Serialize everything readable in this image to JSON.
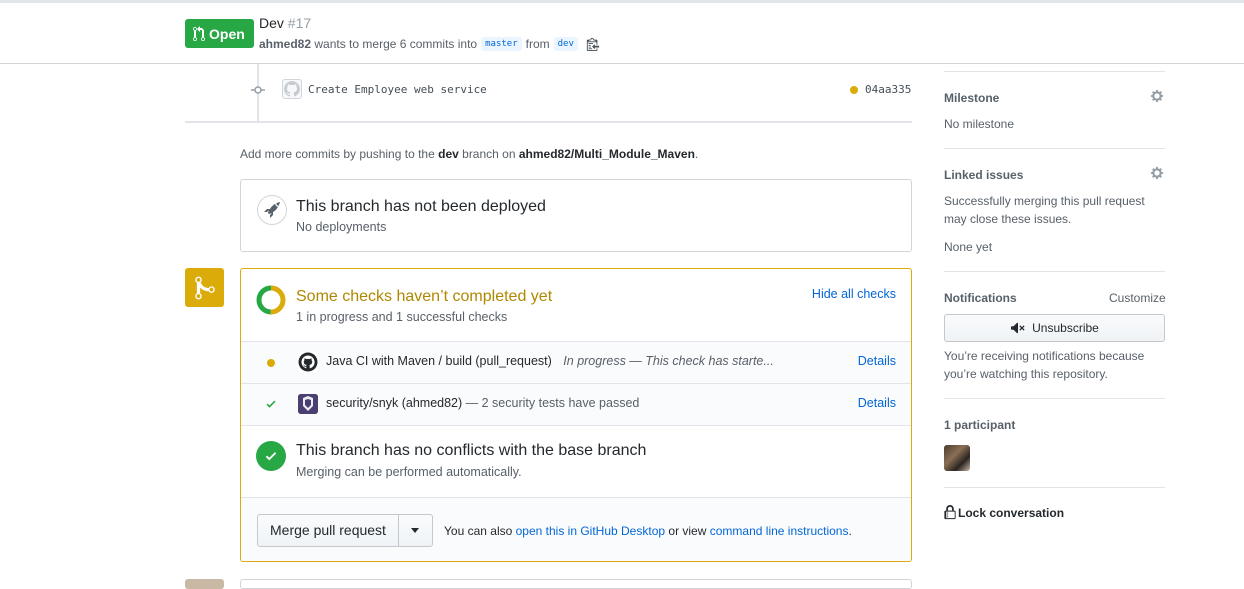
{
  "header": {
    "state_label": "Open",
    "title": "Dev",
    "number": "#17",
    "author": "ahmed82",
    "merge_text": "wants to merge 6 commits into",
    "base_branch": "master",
    "from_text": "from",
    "head_branch": "dev"
  },
  "commit": {
    "message": "Create Employee web service",
    "sha": "04aa335",
    "status_color": "#dbab09"
  },
  "more_commits": {
    "prefix": "Add more commits by pushing to the",
    "branch": "dev",
    "middle": "branch on",
    "repo": "ahmed82/Multi_Module_Maven",
    "suffix": "."
  },
  "deployments": {
    "title": "This branch has not been deployed",
    "subtitle": "No deployments"
  },
  "checks": {
    "title": "Some checks haven’t completed yet",
    "subtitle": "1 in progress and 1 successful checks",
    "hide_label": "Hide all checks",
    "items": [
      {
        "name": "Java CI with Maven / build (pull_request)",
        "description": "In progress — This check has starte...",
        "details": "Details",
        "status": "in-progress"
      },
      {
        "name": "security/snyk (ahmed82)",
        "description": "— 2 security tests have passed",
        "details": "Details",
        "status": "success"
      }
    ]
  },
  "conflicts": {
    "title": "This branch has no conflicts with the base branch",
    "subtitle": "Merging can be performed automatically."
  },
  "merge": {
    "button_label": "Merge pull request",
    "note_prefix": "You can also",
    "desktop_link": "open this in GitHub Desktop",
    "note_middle": "or view",
    "cli_link": "command line instructions",
    "note_suffix": "."
  },
  "sidebar": {
    "milestone": {
      "heading": "Milestone",
      "value": "No milestone"
    },
    "linked_issues": {
      "heading": "Linked issues",
      "description": "Successfully merging this pull request may close these issues.",
      "value": "None yet"
    },
    "notifications": {
      "heading": "Notifications",
      "customize": "Customize",
      "button_label": "Unsubscribe",
      "description": "You’re receiving notifications because you’re watching this repository."
    },
    "participants": {
      "heading": "1 participant"
    },
    "lock_label": "Lock conversation"
  },
  "colors": {
    "open_green": "#28a745",
    "pending_yellow": "#dbab09",
    "link_blue": "#0366d6"
  }
}
